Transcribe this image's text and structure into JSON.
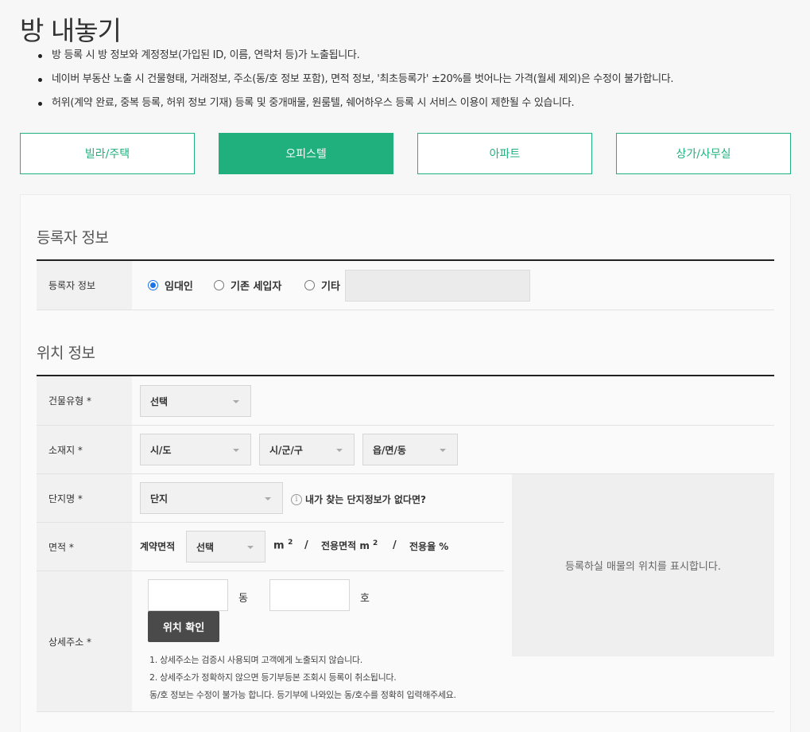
{
  "page": {
    "title": "방 내놓기",
    "notices": [
      "방 등록 시 방 정보와 계정정보(가입된 ID, 이름, 연락처 등)가 노출됩니다.",
      "네이버 부동산 노출 시 건물형태, 거래정보, 주소(동/호 정보 포함), 면적 정보, '최초등록가' ±20%를 벗어나는 가격(월세 제외)은 수정이 불가합니다.",
      "허위(계약 완료, 중복 등록, 허위 정보 기재) 등록 및 중개매물, 원룸텔, 쉐어하우스 등록 시 서비스 이용이 제한될 수 있습니다."
    ]
  },
  "property_types": [
    {
      "label": "빌라/주택",
      "active": false
    },
    {
      "label": "오피스텔",
      "active": true
    },
    {
      "label": "아파트",
      "active": false
    },
    {
      "label": "상가/사무실",
      "active": false
    }
  ],
  "colors": {
    "accent": "#1fb07d",
    "radio_selected": "#1a73e8"
  },
  "registrant": {
    "section_title": "등록자 정보",
    "row_label": "등록자 정보",
    "options": [
      {
        "label": "임대인",
        "selected": true
      },
      {
        "label": "기존 세입자",
        "selected": false
      },
      {
        "label": "기타",
        "selected": false
      }
    ],
    "etc_value": ""
  },
  "location": {
    "section_title": "위치 정보",
    "building_type": {
      "label": "건물유형 *",
      "selected": "선택"
    },
    "address": {
      "label": "소재지 *",
      "sido": "시/도",
      "sigungu": "시/군/구",
      "eupmyeondong": "읍/면/동"
    },
    "complex": {
      "label": "단지명 *",
      "selected": "단지",
      "help_icon": "info-icon",
      "help_text": "내가 찾는 단지정보가 없다면?"
    },
    "area": {
      "label": "면적 *",
      "contract_label": "계약면적",
      "contract_select": "선택",
      "unit": "m",
      "unit_sup": "2",
      "sep1": "/",
      "exclusive_label": "전용면적 m",
      "exclusive_sup": "2",
      "sep2": "/",
      "ratio_label": "전용율 %"
    },
    "detail": {
      "label": "상세주소 *",
      "dong_value": "",
      "dong_unit": "동",
      "ho_value": "",
      "ho_unit": "호",
      "confirm_button": "위치 확인",
      "notes": [
        "1. 상세주소는 검증시 사용되며 고객에게 노출되지 않습니다.",
        "2. 상세주소가 정확하지 않으면 등기부등본 조회시 등록이 취소됩니다.",
        "동/호 정보는 수정이 불가능 합니다. 등기부에 나와있는 동/호수를 정확히 입력해주세요."
      ]
    },
    "map_placeholder": "등록하실 매물의 위치를 표시합니다."
  }
}
